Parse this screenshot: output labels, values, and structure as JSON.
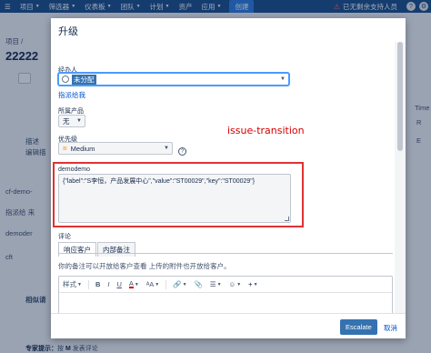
{
  "topnav": {
    "items": [
      {
        "label": "项目",
        "caret": true
      },
      {
        "label": "筛选器",
        "caret": true
      },
      {
        "label": "仪表板",
        "caret": true
      },
      {
        "label": "团队",
        "caret": true
      },
      {
        "label": "计划",
        "caret": true
      },
      {
        "label": "资产",
        "caret": false
      },
      {
        "label": "应用",
        "caret": true
      }
    ],
    "create_label": "创建",
    "notice": "已无剩余支持人员",
    "help_glyph": "?",
    "settings_glyph": "⚙"
  },
  "background": {
    "breadcrumb": "项目 /",
    "title_partial": "22222",
    "desc_label": "描述",
    "edit_label": "编辑描",
    "cf_demo": "cf-demo-",
    "assign_to": "指派给 来",
    "demoder": "demoder",
    "cft": "cft",
    "related": "相似请",
    "right_time": "Time",
    "right_r": "R",
    "right_e": "E"
  },
  "bottom_tip": {
    "prefix": "专家提示：",
    "key": "按",
    "key_letter": "M",
    "suffix": "发表评论"
  },
  "dialog": {
    "title": "升级",
    "assignee_label": "经办人",
    "assignee_value": "未分配",
    "assign_to_me": "指派给我",
    "product_label": "所属产品",
    "product_value": "无",
    "priority_label": "优先级",
    "priority_value": "Medium",
    "priority_glyph": "=",
    "help_glyph": "?",
    "annotation": "issue-transition",
    "demo_label": "demodemo",
    "demo_value": "{\"label\":\"S李恒，产品发展中心\",\"value\":\"ST00029\",\"key\":\"ST00029\"}",
    "comment_label": "评论",
    "tabs": [
      {
        "label": "响应客户",
        "active": true
      },
      {
        "label": "内部备注",
        "active": false
      }
    ],
    "comment_note": "你的备注可以开放给客户查看  上传的附件也开放给客户。",
    "toolbar": {
      "style": "样式",
      "bold": "B",
      "italic": "I",
      "underline": "U",
      "color": "A",
      "more_format": "ᴬA",
      "link": "🔗",
      "attach": "📎",
      "list": "☰",
      "emoji": "☺",
      "plus": "+"
    },
    "escalate_label": "Escalate",
    "cancel_label": "取消"
  }
}
